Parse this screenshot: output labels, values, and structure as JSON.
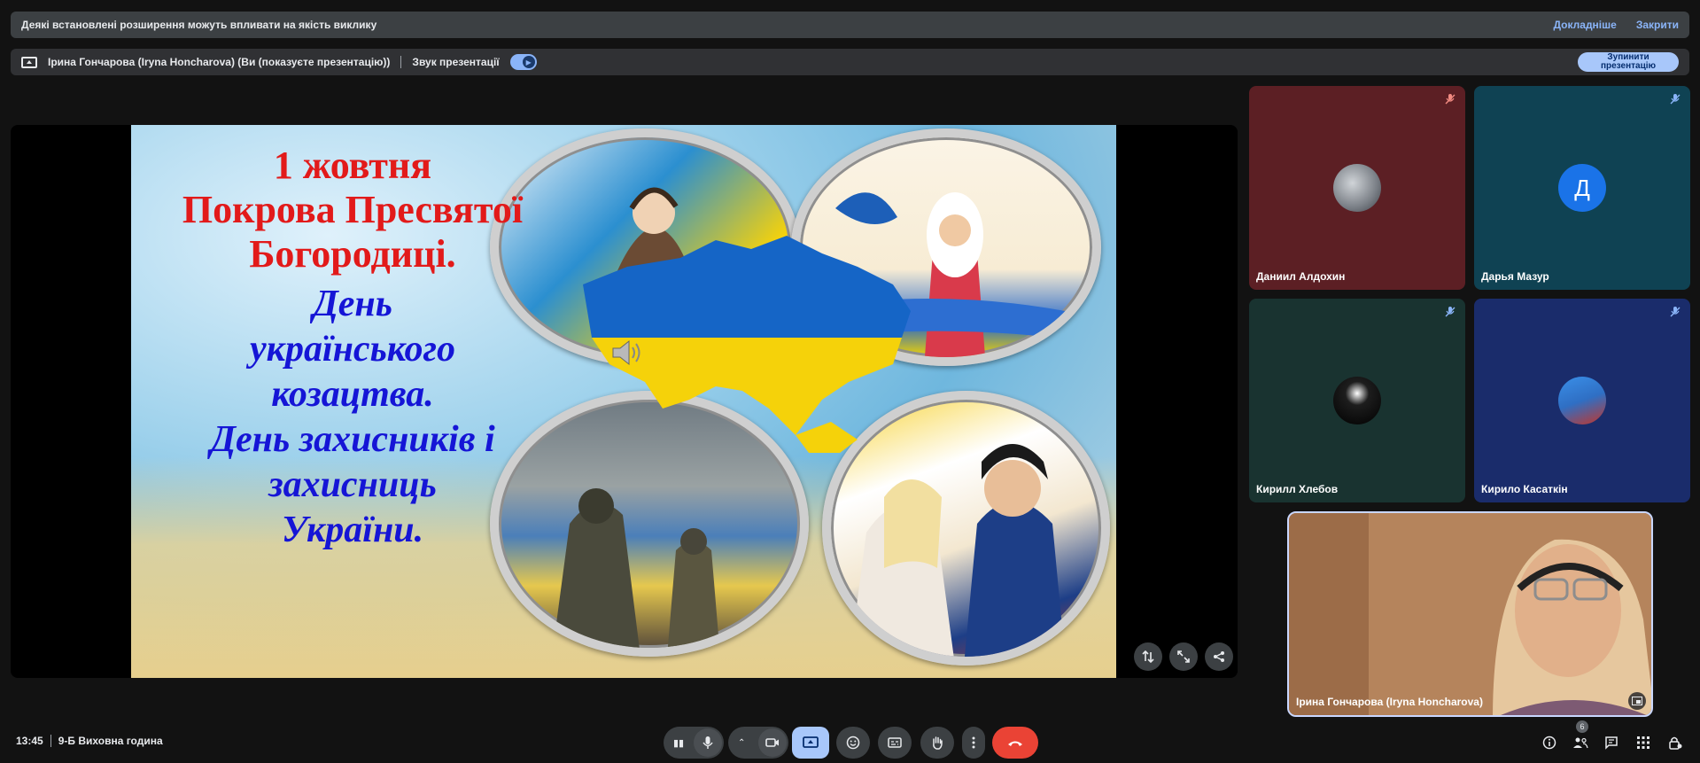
{
  "banner": {
    "message": "Деякі встановлені розширення можуть впливати на якість виклику",
    "details_link": "Докладніше",
    "close_link": "Закрити"
  },
  "presentation_bar": {
    "presenter": "Ірина Гончарова (Iryna Honcharova) (Ви (показуєте презентацію))",
    "sound_label": "Звук презентації",
    "sound_on": true,
    "stop_button": "Зупинити презентацію"
  },
  "slide": {
    "title_lines": [
      "1 жовтня",
      "Покрова Пресвятої",
      "Богородиці."
    ],
    "subtitle_lines": [
      "День",
      "українського",
      "козацтва.",
      "День захисників і",
      "захисниць",
      "України."
    ]
  },
  "participants": [
    {
      "name": "Даниил Алдохин",
      "muted": true,
      "color": "#5c1f24"
    },
    {
      "name": "Дарья Мазур",
      "muted": true,
      "initial": "Д",
      "color": "#0f4253"
    },
    {
      "name": "Кирилл Хлебов",
      "muted": true,
      "color": "#193330"
    },
    {
      "name": "Кирило Касаткін",
      "muted": true,
      "color": "#1a2c6b"
    }
  ],
  "self_view": {
    "name": "Ірина Гончарова (Iryna Honcharova)"
  },
  "bottom_bar": {
    "time": "13:45",
    "meeting_name": "9-Б Виховна година",
    "people_count": "6"
  }
}
